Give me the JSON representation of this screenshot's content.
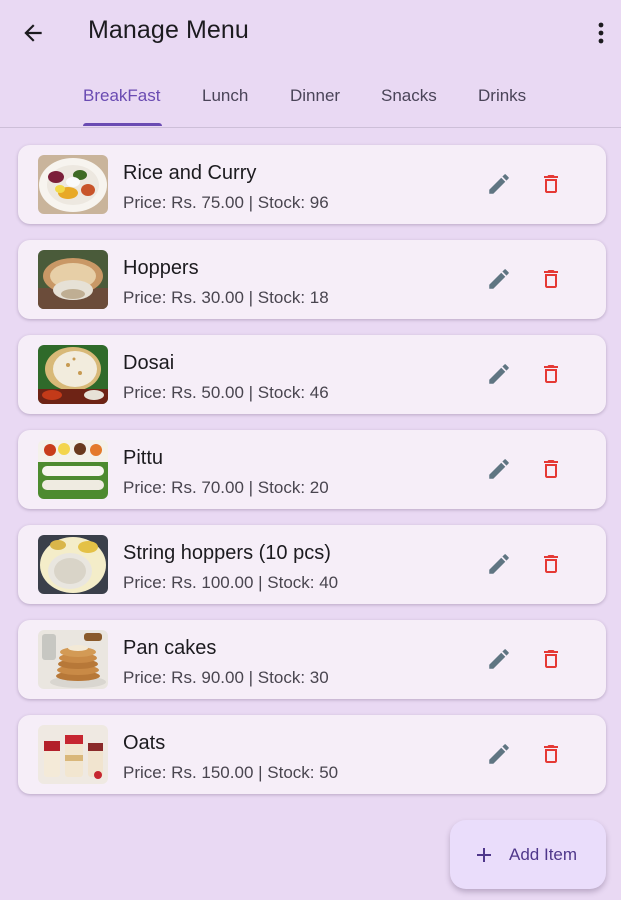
{
  "header": {
    "title": "Manage Menu",
    "back_icon": "arrow-left-icon",
    "more_icon": "more-vert-icon"
  },
  "tabs": [
    {
      "label": "BreakFast",
      "active": true
    },
    {
      "label": "Lunch",
      "active": false
    },
    {
      "label": "Dinner",
      "active": false
    },
    {
      "label": "Snacks",
      "active": false
    },
    {
      "label": "Drinks",
      "active": false
    }
  ],
  "items": [
    {
      "name": "Rice and Curry",
      "meta": "Price: Rs. 75.00 | Stock: 96"
    },
    {
      "name": "Hoppers",
      "meta": "Price: Rs. 30.00 | Stock: 18"
    },
    {
      "name": "Dosai",
      "meta": "Price: Rs. 50.00 | Stock: 46"
    },
    {
      "name": "Pittu",
      "meta": "Price: Rs. 70.00 | Stock: 20"
    },
    {
      "name": "String hoppers (10 pcs)",
      "meta": "Price: Rs. 100.00 | Stock: 40"
    },
    {
      "name": "Pan cakes",
      "meta": "Price: Rs. 90.00 | Stock: 30"
    },
    {
      "name": "Oats",
      "meta": "Price: Rs. 150.00 | Stock: 50"
    }
  ],
  "fab": {
    "label": "Add Item",
    "icon": "plus-icon"
  },
  "colors": {
    "background": "#e9d9f3",
    "accent": "#6a4bb2",
    "edit_icon": "#5f7582",
    "delete_icon": "#e53935",
    "card": "#f6eef8",
    "fab": "#eaddfb"
  }
}
